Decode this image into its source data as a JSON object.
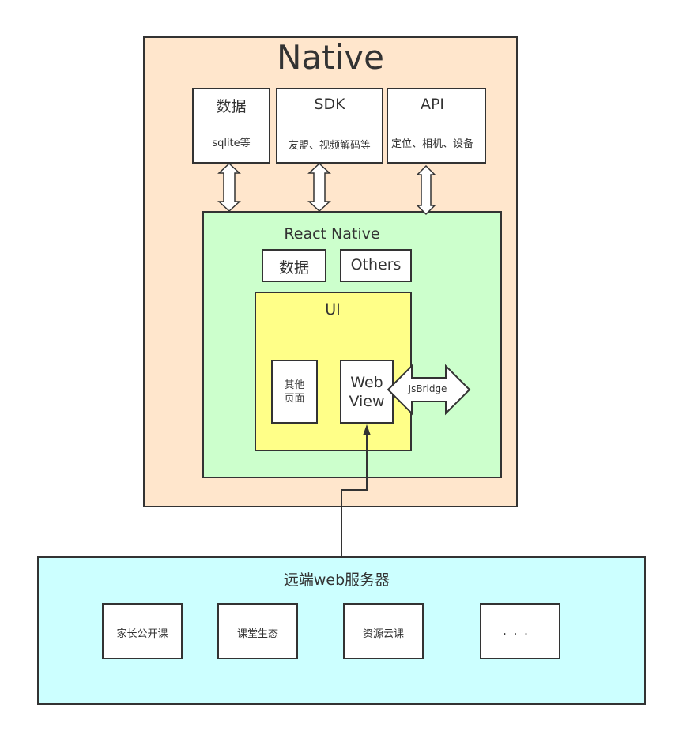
{
  "native": {
    "title": "Native",
    "boxes": [
      {
        "title": "数据",
        "subtitle": "sqlite等"
      },
      {
        "title": "SDK",
        "subtitle": "友盟、视频解码等"
      },
      {
        "title": "API",
        "subtitle": "定位、相机、设备"
      }
    ]
  },
  "react_native": {
    "title": "React Native",
    "data_label": "数据",
    "others_label": "Others",
    "ui": {
      "title": "UI",
      "other_pages": "其他\n页面",
      "webview": "Web\nView"
    }
  },
  "jsbridge_label": "JsBridge",
  "remote": {
    "title": "远端web服务器",
    "items": [
      "家长公开课",
      "课堂生态",
      "资源云课",
      ". . ."
    ]
  },
  "colors": {
    "native_bg": "#ffe6cc",
    "rn_bg": "#ccffcc",
    "ui_bg": "#ffff88",
    "remote_bg": "#ccffff",
    "stroke": "#333333"
  }
}
